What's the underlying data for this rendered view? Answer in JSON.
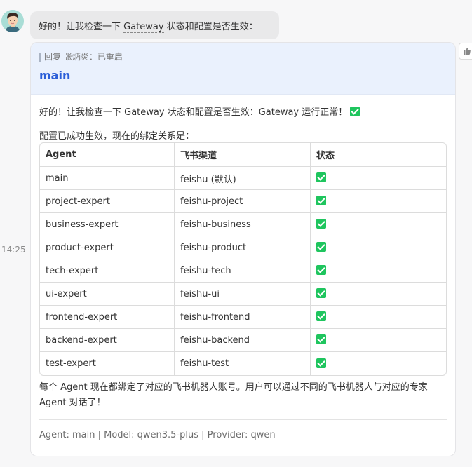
{
  "top_message": {
    "pre": "好的！让我检查一下 ",
    "highlight": "Gateway",
    "post": " 状态和配置是否生效："
  },
  "reply": {
    "label": "回复 张炳炎：已重启",
    "name": "main"
  },
  "body": {
    "line1": "好的！让我检查一下 Gateway 状态和配置是否生效：Gateway 运行正常！",
    "line2": "配置已成功生效，现在的绑定关系是："
  },
  "table": {
    "headers": [
      "Agent",
      "飞书渠道",
      "状态"
    ],
    "rows": [
      {
        "agent": "main",
        "channel": "feishu (默认)"
      },
      {
        "agent": "project-expert",
        "channel": "feishu-project"
      },
      {
        "agent": "business-expert",
        "channel": "feishu-business"
      },
      {
        "agent": "product-expert",
        "channel": "feishu-product"
      },
      {
        "agent": "tech-expert",
        "channel": "feishu-tech"
      },
      {
        "agent": "ui-expert",
        "channel": "feishu-ui"
      },
      {
        "agent": "frontend-expert",
        "channel": "feishu-frontend"
      },
      {
        "agent": "backend-expert",
        "channel": "feishu-backend"
      },
      {
        "agent": "test-expert",
        "channel": "feishu-test"
      }
    ]
  },
  "note": "每个 Agent 现在都绑定了对应的飞书机器人账号。用户可以通过不同的飞书机器人与对应的专家 Agent 对话了！",
  "meta": "Agent: main | Model: qwen3.5-plus | Provider: qwen",
  "timestamp": "14:25",
  "colors": {
    "accent": "#2b5ed8",
    "check": "#1fc55e",
    "reply_bg": "#eaf1fd"
  }
}
